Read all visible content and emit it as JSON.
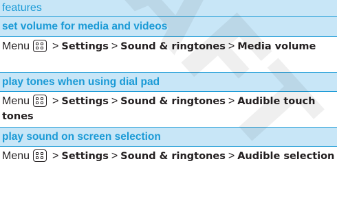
{
  "watermark": "DRAFT",
  "section": {
    "title": "features"
  },
  "topics": [
    {
      "heading": "set volume for media and videos",
      "menu": "Menu",
      "step1": "Settings",
      "step2": "Sound & ringtones",
      "step3": "Media volume"
    },
    {
      "heading": "play tones when using dial pad",
      "menu": "Menu",
      "step1": "Settings",
      "step2": "Sound & ringtones",
      "step3": "Audible touch tones"
    },
    {
      "heading": "play sound on screen selection",
      "menu": "Menu",
      "step1": "Settings",
      "step2": "Sound & ringtones",
      "step3": "Audible selection"
    }
  ],
  "separator": ">",
  "icons": {
    "menu_key": "menu-key-icon"
  },
  "colors": {
    "accent": "#1a9ad6",
    "band": "#c8e6f7",
    "text": "#231f20"
  }
}
